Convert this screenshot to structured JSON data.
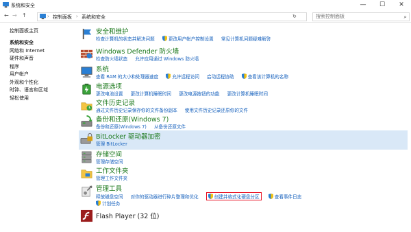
{
  "window": {
    "title": "系统和安全",
    "minimize_glyph": "—",
    "maximize_glyph": "☐",
    "close_glyph": "✕"
  },
  "address": {
    "back_glyph": "←",
    "forward_glyph": "→",
    "up_glyph": "↑",
    "breadcrumb": [
      "控制面板",
      "系统和安全"
    ],
    "separator": "›",
    "search_placeholder": "搜索控制面板",
    "refresh_glyph": "↻"
  },
  "sidebar": {
    "home": "控制面板主页",
    "items": [
      {
        "label": "系统和安全",
        "active": true
      },
      {
        "label": "网络和 Internet",
        "active": false
      },
      {
        "label": "硬件和声音",
        "active": false
      },
      {
        "label": "程序",
        "active": false
      },
      {
        "label": "用户帐户",
        "active": false
      },
      {
        "label": "外观和个性化",
        "active": false
      },
      {
        "label": "时钟、语言和区域",
        "active": false
      },
      {
        "label": "轻松使用",
        "active": false
      }
    ]
  },
  "categories": {
    "security": {
      "title": "安全和维护",
      "icon": "flag-icon",
      "links": [
        "检查计算机的状态并解决问题",
        "更改用户帐户控制设置",
        "常见计算机问题疑难解答"
      ]
    },
    "firewall": {
      "title": "Windows Defender 防火墙",
      "icon": "firewall-icon",
      "links": [
        "检查防火墙状态",
        "允许应用通过 Windows 防火墙"
      ]
    },
    "system": {
      "title": "系统",
      "icon": "computer-icon",
      "links": [
        "查看 RAM 的大小和处理器速度",
        "允许远程访问",
        "启动远程协助",
        "查看该计算机的名称"
      ]
    },
    "power": {
      "title": "电源选项",
      "icon": "battery-icon",
      "links": [
        "更改电池设置",
        "更改计算机睡眠时间",
        "更改电源按钮的功能",
        "更改计算机睡眠时间"
      ]
    },
    "filehistory": {
      "title": "文件历史记录",
      "icon": "file-history-icon",
      "links": [
        "通过文件历史记录保存你的文件备份副本",
        "使用文件历史记录还原你的文件"
      ]
    },
    "backup": {
      "title": "备份和还原(Windows 7)",
      "icon": "backup-icon",
      "links": [
        "备份和还原(Windows 7)",
        "从备份还原文件"
      ]
    },
    "bitlocker": {
      "title": "BitLocker 驱动器加密",
      "icon": "bitlocker-icon",
      "links": [
        "管理 BitLocker"
      ]
    },
    "storage": {
      "title": "存储空间",
      "icon": "storage-icon",
      "links": [
        "管理存储空间"
      ]
    },
    "workfolders": {
      "title": "工作文件夹",
      "icon": "work-folders-icon",
      "links": [
        "管理工作文件夹"
      ]
    },
    "admintools": {
      "title": "管理工具",
      "icon": "admin-tools-icon",
      "links": [
        "释放磁盘空间",
        "对你的驱动器进行碎片整理和优化",
        "创建并格式化硬盘分区",
        "查看事件日志",
        "计划任务"
      ]
    },
    "flash": {
      "title": "Flash Player (32 位)",
      "icon": "flash-icon"
    }
  },
  "colors": {
    "category_title": "#1e7a1e",
    "link": "#1560bd",
    "selected_bg": "#d9e8f7",
    "highlight_border": "#e81123"
  }
}
